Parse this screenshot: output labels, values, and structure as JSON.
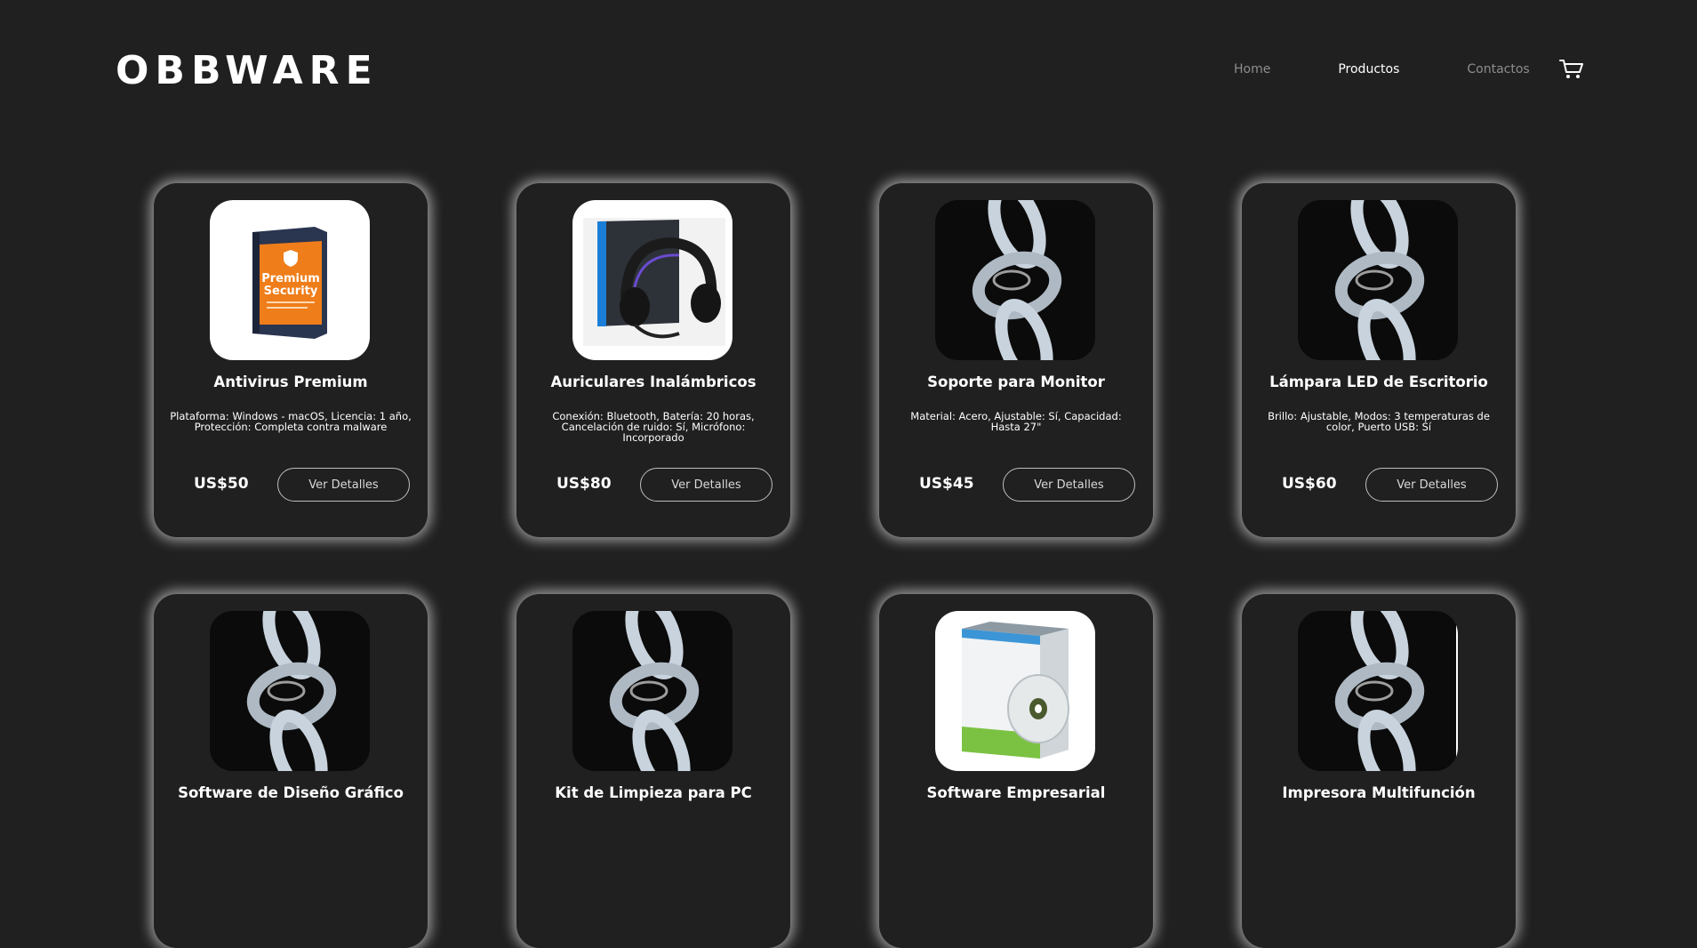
{
  "header": {
    "logo": "OBBWARE",
    "nav": [
      {
        "label": "Home",
        "active": false
      },
      {
        "label": "Productos",
        "active": true
      },
      {
        "label": "Contactos",
        "active": false
      }
    ],
    "cart_icon": "cart-icon"
  },
  "products": [
    {
      "title": "Antivirus Premium",
      "desc": "Plataforma: Windows - macOS, Licencia: 1 año, Protección: Completa contra malware",
      "price": "US$50",
      "button": "Ver Detalles",
      "image": "antivirus-box",
      "image_text": [
        "Premium",
        "Security"
      ]
    },
    {
      "title": "Auriculares Inalámbricos",
      "desc": "Conexión: Bluetooth, Batería: 20 horas, Cancelación de ruido: Sí, Micrófono: Incorporado",
      "price": "US$80",
      "button": "Ver Detalles",
      "image": "headphones"
    },
    {
      "title": "Soporte para Monitor",
      "desc": "Material: Acero, Ajustable: Sí, Capacidad: Hasta 27\"",
      "price": "US$45",
      "button": "Ver Detalles",
      "image": "chain"
    },
    {
      "title": "Lámpara LED de Escritorio",
      "desc": "Brillo: Ajustable, Modos: 3 temperaturas de color, Puerto USB: Sí",
      "price": "US$60",
      "button": "Ver Detalles",
      "image": "chain"
    },
    {
      "title": "Software de Diseño Gráfico",
      "desc": "",
      "price": "",
      "button": "",
      "image": "chain"
    },
    {
      "title": "Kit de Limpieza para PC",
      "desc": "",
      "price": "",
      "button": "",
      "image": "chain"
    },
    {
      "title": "Software Empresarial",
      "desc": "",
      "price": "",
      "button": "",
      "image": "software-box"
    },
    {
      "title": "Impresora Multifunción",
      "desc": "",
      "price": "",
      "button": "",
      "image": "chain"
    }
  ],
  "colors": {
    "background": "#202020",
    "text": "#ffffff",
    "nav_inactive": "#8d8d8d",
    "card_glow": "#ffffff"
  }
}
